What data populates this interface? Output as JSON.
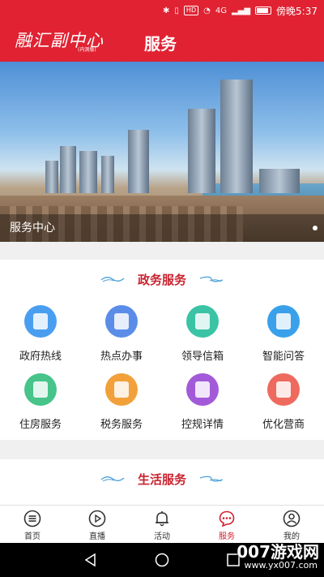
{
  "status_bar": {
    "hd": "HD",
    "net": "4G",
    "time": "傍晚5:37"
  },
  "header": {
    "logo": "融汇副中心",
    "logo_sub": "(内测版)",
    "title": "服务"
  },
  "banner": {
    "caption": "服务中心"
  },
  "gov_section": {
    "title": "政务服务",
    "items": [
      {
        "label": "政府热线",
        "color": "#4a9ef0"
      },
      {
        "label": "热点办事",
        "color": "#5a8de8"
      },
      {
        "label": "领导信箱",
        "color": "#3ac3a5"
      },
      {
        "label": "智能问答",
        "color": "#3aa0ea"
      },
      {
        "label": "住房服务",
        "color": "#46c48a"
      },
      {
        "label": "税务服务",
        "color": "#f2a03a"
      },
      {
        "label": "控规详情",
        "color": "#a35ad9"
      },
      {
        "label": "优化营商",
        "color": "#ef6a5e"
      }
    ]
  },
  "life_section": {
    "title": "生活服务"
  },
  "bottom_nav": {
    "items": [
      {
        "label": "首页",
        "icon": "menu-icon"
      },
      {
        "label": "直播",
        "icon": "play-icon"
      },
      {
        "label": "活动",
        "icon": "bell-icon"
      },
      {
        "label": "服务",
        "icon": "chat-icon"
      },
      {
        "label": "我的",
        "icon": "user-icon"
      }
    ],
    "active_color": "#d0202f"
  },
  "watermark": {
    "text": "007游戏网",
    "url": "www.yx007.com"
  }
}
